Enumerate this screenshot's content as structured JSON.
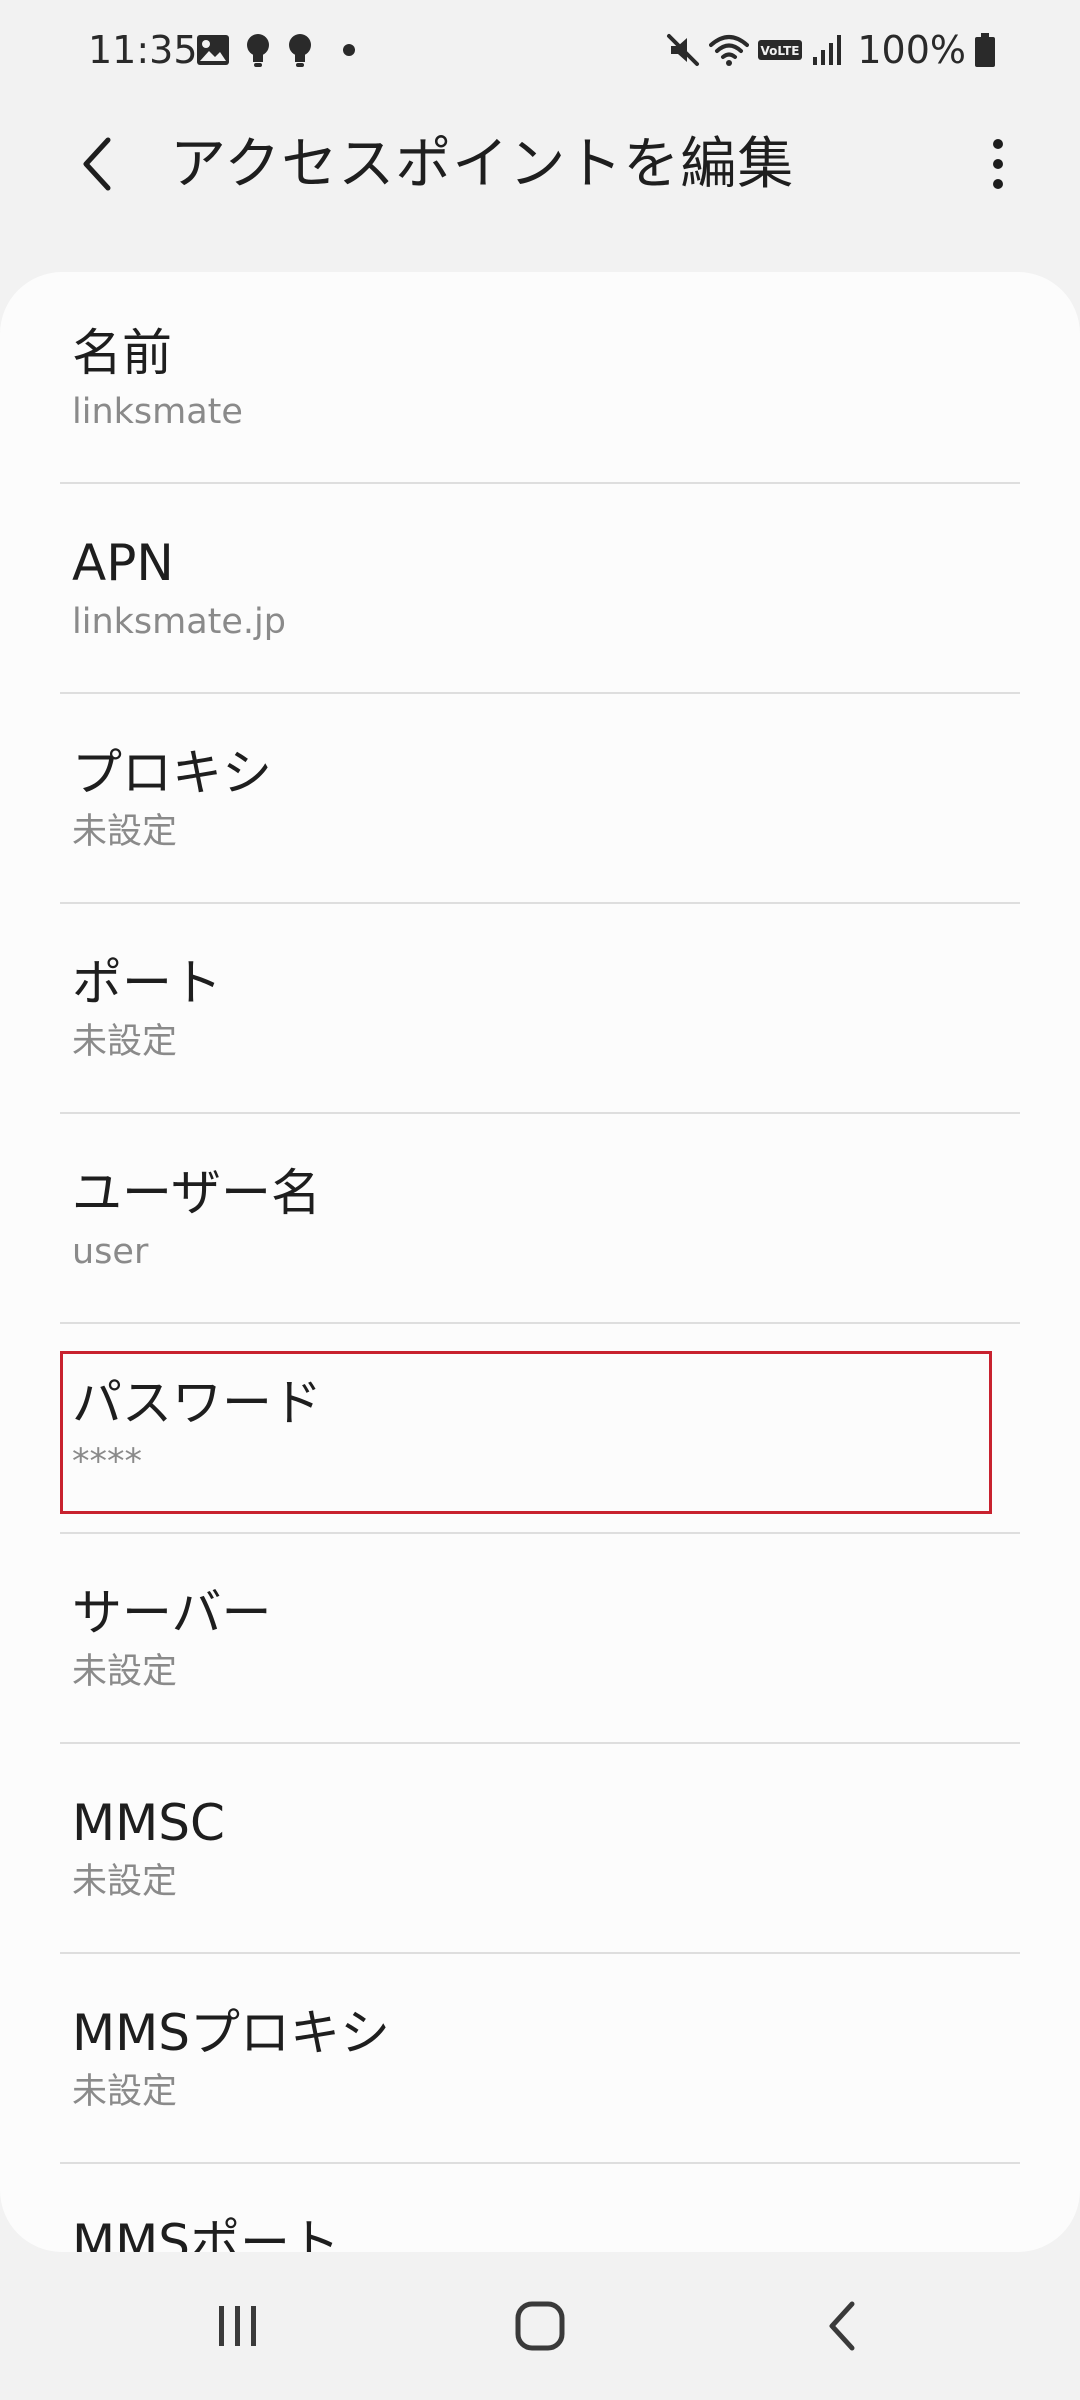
{
  "status_bar": {
    "time": "11:35",
    "battery": "100%",
    "network_badge": "VoLTE",
    "icons": [
      "gallery-icon",
      "bulb-icon",
      "bulb-icon",
      "dot-icon",
      "mute-icon",
      "wifi-icon",
      "volte-icon",
      "signal-icon",
      "battery-icon"
    ]
  },
  "app_bar": {
    "title": "アクセスポイントを編集",
    "back_icon": "back-chevron-icon",
    "more_icon": "more-vert-icon"
  },
  "settings": [
    {
      "title": "名前",
      "value": "linksmate"
    },
    {
      "title": "APN",
      "value": "linksmate.jp"
    },
    {
      "title": "プロキシ",
      "value": "未設定"
    },
    {
      "title": "ポート",
      "value": "未設定"
    },
    {
      "title": "ユーザー名",
      "value": "user"
    },
    {
      "title": "パスワード",
      "value": "****"
    },
    {
      "title": "サーバー",
      "value": "未設定"
    },
    {
      "title": "MMSC",
      "value": "未設定"
    },
    {
      "title": "MMSプロキシ",
      "value": "未設定"
    },
    {
      "title": "MMSポート",
      "value": ""
    }
  ],
  "highlight": {
    "target": "パスワード",
    "color": "#c8222f"
  },
  "nav_bar": {
    "icons": [
      "recents-icon",
      "home-icon",
      "back-icon"
    ]
  },
  "colors": {
    "background": "#f2f2f2",
    "card": "#fcfcfc",
    "title_text": "#1e1e1e",
    "secondary_text": "#8a8a8a",
    "divider": "#dedede"
  }
}
